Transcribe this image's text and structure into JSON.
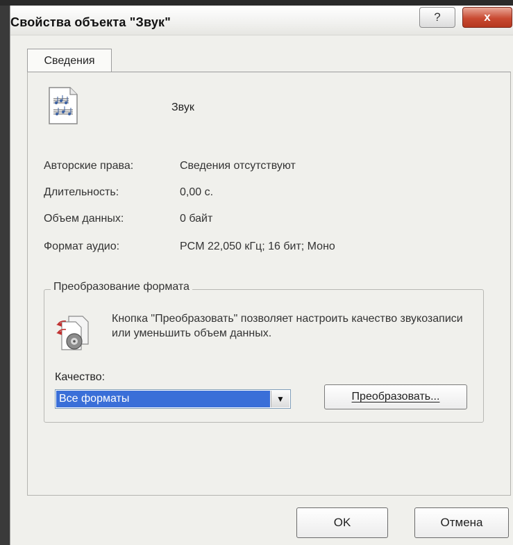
{
  "window": {
    "title": "Свойства объекта \"Звук\"",
    "help_label": "?",
    "close_label": "x"
  },
  "tabs": [
    {
      "label": "Сведения",
      "active": true
    }
  ],
  "file": {
    "name": "Звук",
    "icon": "sound-file-icon"
  },
  "properties": [
    {
      "label": "Авторские права:",
      "value": "Сведения отсутствуют"
    },
    {
      "label": "Длительность:",
      "value": "0,00 с."
    },
    {
      "label": "Объем данных:",
      "value": "0 байт"
    },
    {
      "label": "Формат аудио:",
      "value": "PCM 22,050 кГц; 16 бит; Моно"
    }
  ],
  "conversion": {
    "group_title": "Преобразование формата",
    "icon": "convert-icon",
    "description": "Кнопка \"Преобразовать\" позволяет настроить качество звукозаписи или уменьшить объем данных.",
    "quality_label": "Качество:",
    "quality_selected": "Все форматы",
    "convert_button": "Преобразовать..."
  },
  "buttons": {
    "ok": "OK",
    "cancel": "Отмена"
  },
  "colors": {
    "close_button": "#c94a32",
    "selection": "#3a6fd8"
  }
}
